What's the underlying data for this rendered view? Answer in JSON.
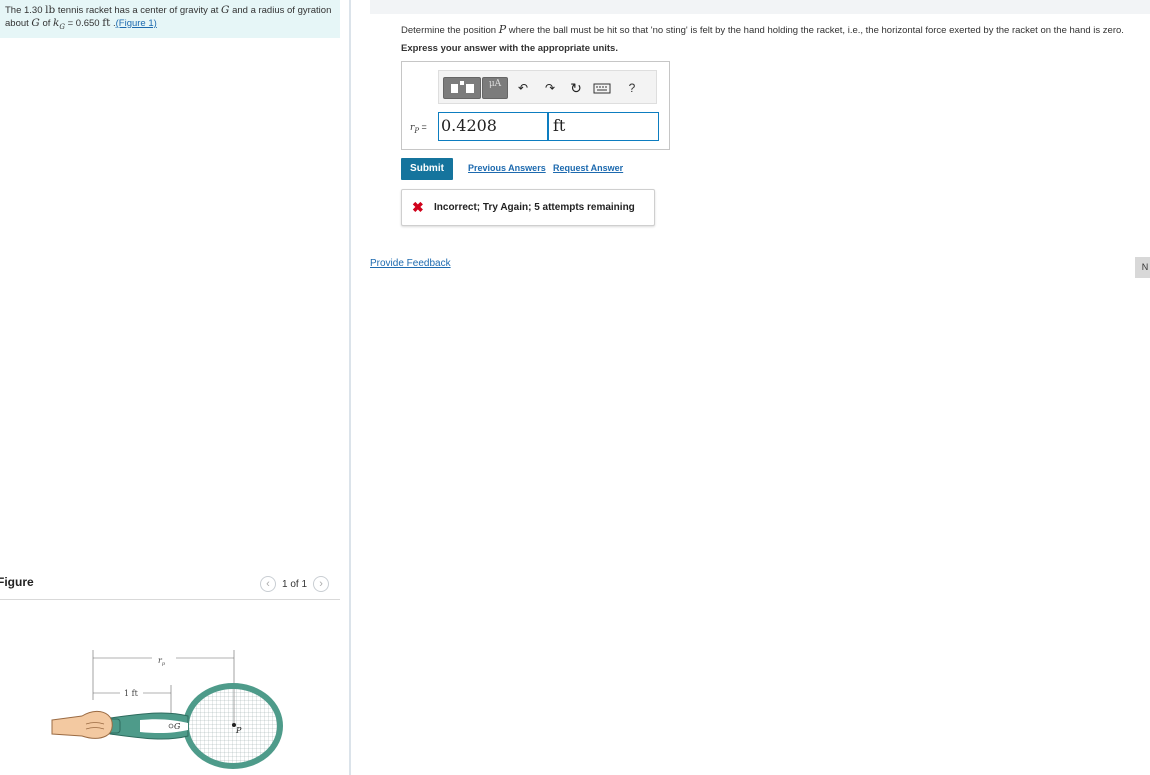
{
  "problem": {
    "text_1": "The 1.30 ",
    "unit_lb": "lb",
    "text_2": " tennis racket has a center of gravity at ",
    "sym_G": "G",
    "text_3": " and a radius of gyration about ",
    "sym_G2": "G",
    "text_4": " of ",
    "sym_kG": "k",
    "sym_kG_sub": "G",
    "text_5": " = 0.650 ",
    "unit_ft": "ft",
    "text_6": " .",
    "figure_link": "(Figure 1)"
  },
  "figure": {
    "header": "Figure",
    "pager_text": "1 of 1",
    "prev_icon": "chevron-left-icon",
    "next_icon": "chevron-right-icon",
    "label_rp": "r",
    "label_rp_sub": "p",
    "label_1ft": "1 ft",
    "label_G": "G",
    "label_P": "P"
  },
  "question": {
    "text_1": "Determine the position ",
    "sym_P": "P",
    "text_2": " where the ball must be hit so that 'no sting' is felt by the hand holding the racket, i.e., the horizontal force exerted by the racket on the hand is zero.",
    "instruction": "Express your answer with the appropriate units."
  },
  "answer": {
    "label_r": "r",
    "label_sub": "P",
    "label_eq": " =",
    "value": "0.4208",
    "unit": "ft",
    "toolbar": {
      "units_label": "μA",
      "undo_icon": "undo-icon",
      "redo_icon": "redo-icon",
      "reset_icon": "reset-icon",
      "keyboard_icon": "keyboard-icon",
      "help_label": "?"
    }
  },
  "actions": {
    "submit": "Submit",
    "previous_answers": "Previous Answers",
    "request_answer": "Request Answer"
  },
  "feedback": {
    "icon": "x-icon",
    "message": "Incorrect; Try Again; 5 attempts remaining"
  },
  "provide_feedback": "Provide Feedback",
  "next_tab": "N",
  "colors": {
    "accent": "#15749d",
    "link": "#1d6aaf",
    "error": "#d0021b",
    "problem_bg": "#e6f6f7",
    "racket": "#4e9b8a"
  }
}
